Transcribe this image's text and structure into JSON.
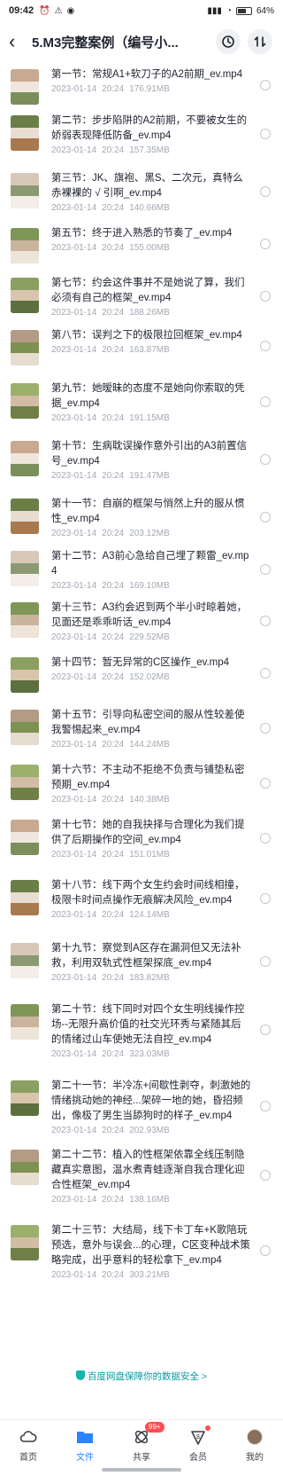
{
  "status_bar": {
    "time": "09:42",
    "battery": "64%"
  },
  "header": {
    "title": "5.M3完整案例（编号小..."
  },
  "files": [
    {
      "name": "第一节：常规A1+软刀子的A2前期_ev.mp4",
      "date": "2023-01-14",
      "time": "20:24",
      "size": "176.91MB"
    },
    {
      "name": "第二节：步步陷阱的A2前期，不要被女生的娇弱表现降低防备_ev.mp4",
      "date": "2023-01-14",
      "time": "20:24",
      "size": "157.35MB"
    },
    {
      "name": "第三节：JK、旗袍、黑S、二次元，真特么赤裸裸的 √ 引啊_ev.mp4",
      "date": "2023-01-14",
      "time": "20:24",
      "size": "140.66MB"
    },
    {
      "name": "第五节：终于进入熟悉的节奏了_ev.mp4",
      "date": "2023-01-14",
      "time": "20:24",
      "size": "155.00MB"
    },
    {
      "name": "第七节：约会这件事并不是她说了算，我们必须有自己的框架_ev.mp4",
      "date": "2023-01-14",
      "time": "20:24",
      "size": "188.26MB"
    },
    {
      "name": "第八节：误判之下的极限拉回框架_ev.mp4",
      "date": "2023-01-14",
      "time": "20:24",
      "size": "163.87MB"
    },
    {
      "name": "第九节：她暧昧的态度不是她向你索取的凭据_ev.mp4",
      "date": "2023-01-14",
      "time": "20:24",
      "size": "191.15MB"
    },
    {
      "name": "第十节：生病耽误操作意外引出的A3前置信号_ev.mp4",
      "date": "2023-01-14",
      "time": "20:24",
      "size": "191.47MB"
    },
    {
      "name": "第十一节：自崩的框架与悄然上升的服从惯性_ev.mp4",
      "date": "2023-01-14",
      "time": "20:24",
      "size": "203.12MB"
    },
    {
      "name": "第十二节：A3前心急给自己埋了颗雷_ev.mp4",
      "date": "2023-01-14",
      "time": "20:24",
      "size": "169.10MB"
    },
    {
      "name": "第十三节：A3约会迟到两个半小时晾着她，见面还是乖乖听话_ev.mp4",
      "date": "2023-01-14",
      "time": "20:24",
      "size": "229.52MB"
    },
    {
      "name": "第十四节：暂无异常的C区操作_ev.mp4",
      "date": "2023-01-14",
      "time": "20:24",
      "size": "152.02MB"
    },
    {
      "name": "第十五节：引导向私密空间的服从性较差使我警惕起来_ev.mp4",
      "date": "2023-01-14",
      "time": "20:24",
      "size": "144.24MB"
    },
    {
      "name": "第十六节：不主动不拒绝不负责与铺垫私密预期_ev.mp4",
      "date": "2023-01-14",
      "time": "20:24",
      "size": "140.38MB"
    },
    {
      "name": "第十七节：她的自我抉择与合理化为我们提供了后期操作的空间_ev.mp4",
      "date": "2023-01-14",
      "time": "20:24",
      "size": "151.01MB"
    },
    {
      "name": "第十八节：线下两个女生约会时间线相撞，极限卡时间点操作无痕解决风险_ev.mp4",
      "date": "2023-01-14",
      "time": "20:24",
      "size": "124.14MB"
    },
    {
      "name": "第十九节：察觉到A区存在漏洞但又无法补救，利用双轨式性框架探底_ev.mp4",
      "date": "2023-01-14",
      "time": "20:24",
      "size": "183.82MB"
    },
    {
      "name": "第二十节：线下同时对四个女生明线操作控场--无限升高价值的社交光环秀与紧随其后的情绪过山车使她无法自控_ev.mp4",
      "date": "2023-01-14",
      "time": "20:24",
      "size": "323.03MB"
    },
    {
      "name": "第二十一节：半冷冻+间歇性剥夺，刺激她的情绪挑动她的神经...架碎一地的她，昏招频出，像极了男生当舔狗时的样子_ev.mp4",
      "date": "2023-01-14",
      "time": "20:24",
      "size": "202.93MB"
    },
    {
      "name": "第二十二节：植入的性框架依靠全线压制隐藏真实意图，温水煮青蛙逐渐自我合理化迎合性框架_ev.mp4",
      "date": "2023-01-14",
      "time": "20:24",
      "size": "138.16MB"
    },
    {
      "name": "第二十三节：大结局，线下卡丁车+K歌陪玩预选，意外与误会...的心理，C区变种战术策略完成，出乎意料的轻松拿下_ev.mp4",
      "date": "2023-01-14",
      "time": "20:24",
      "size": "303.21MB"
    }
  ],
  "footer_note": "百度网盘保障你的数据安全 >",
  "nav": {
    "items": [
      {
        "label": "首页",
        "icon": "home-cloud-icon"
      },
      {
        "label": "文件",
        "icon": "folder-icon"
      },
      {
        "label": "共享",
        "icon": "share-icon",
        "badge": "99+"
      },
      {
        "label": "会员",
        "icon": "vip-icon"
      },
      {
        "label": "我的",
        "icon": "profile-avatar"
      }
    ]
  },
  "colors": {
    "accent": "#2a84ff",
    "secure": "#0a9a9e",
    "text": "#1f2330",
    "meta": "#a3a8b3"
  }
}
